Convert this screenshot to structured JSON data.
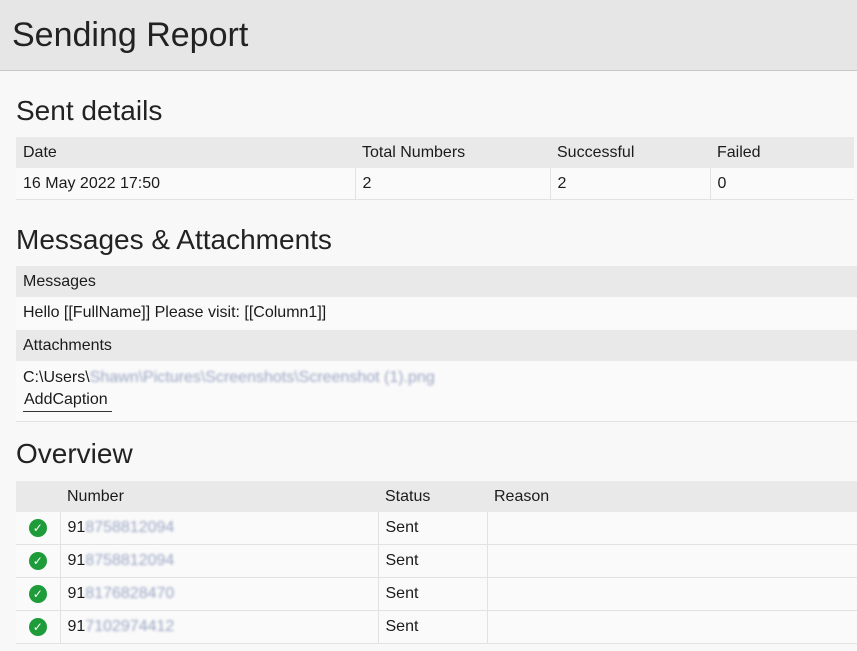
{
  "header": {
    "title": "Sending Report"
  },
  "sent_details": {
    "title": "Sent details",
    "columns": [
      "Date",
      "Total Numbers",
      "Successful",
      "Failed"
    ],
    "row": [
      "16 May 2022 17:50",
      "2",
      "2",
      "0"
    ]
  },
  "messages": {
    "title": "Messages & Attachments",
    "messages_label": "Messages",
    "message_text": "Hello [[FullName]] Please visit: [[Column1]]",
    "attachments_label": "Attachments",
    "attachment_path_prefix": "C:\\Users\\",
    "attachment_path_blurred": "Shawn\\Pictures\\Screenshots\\Screenshot (1).png",
    "add_caption": "AddCaption"
  },
  "overview": {
    "title": "Overview",
    "columns": [
      "",
      "Number",
      "Status",
      "Reason"
    ],
    "rows": [
      {
        "prefix": "91",
        "blurred": "8758812094",
        "status": "Sent",
        "reason": ""
      },
      {
        "prefix": "91",
        "blurred": "8758812094",
        "status": "Sent",
        "reason": ""
      },
      {
        "prefix": "91",
        "blurred": "8176828470",
        "status": "Sent",
        "reason": ""
      },
      {
        "prefix": "91",
        "blurred": "7102974412",
        "status": "Sent",
        "reason": ""
      }
    ],
    "status_icon": "check-circle-icon",
    "status_color": "#1e9c3a"
  }
}
